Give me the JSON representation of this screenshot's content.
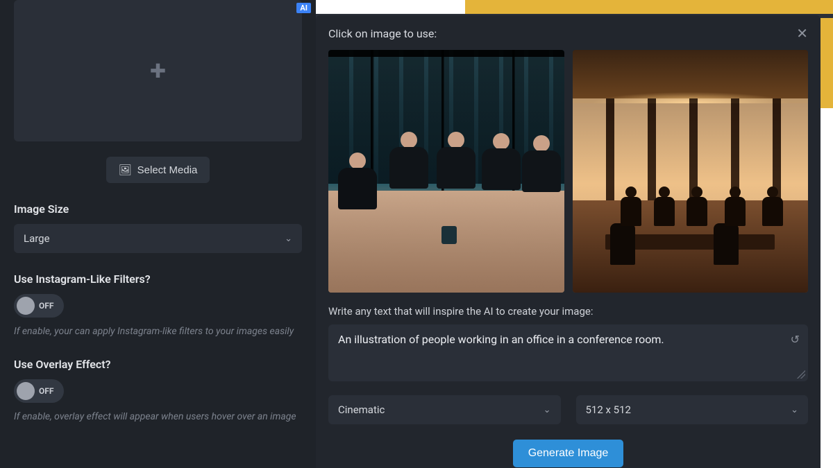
{
  "sidebar": {
    "ai_badge": "AI",
    "select_media_label": "Select Media",
    "image_size": {
      "label": "Image Size",
      "value": "Large"
    },
    "filters": {
      "label": "Use Instagram-Like Filters?",
      "state": "OFF",
      "hint": "If enable, your can apply Instagram-like filters to your images easily"
    },
    "overlay": {
      "label": "Use Overlay Effect?",
      "state": "OFF",
      "hint": "If enable, overlay effect will appear when users hover over an image"
    }
  },
  "modal": {
    "title": "Click on image to use:",
    "prompt_label": "Write any text that will inspire the AI to create your image:",
    "prompt_value": "An illustration of people working in an office in a conference room.",
    "style_select": "Cinematic",
    "size_select": "512 x 512",
    "generate_label": "Generate Image"
  }
}
